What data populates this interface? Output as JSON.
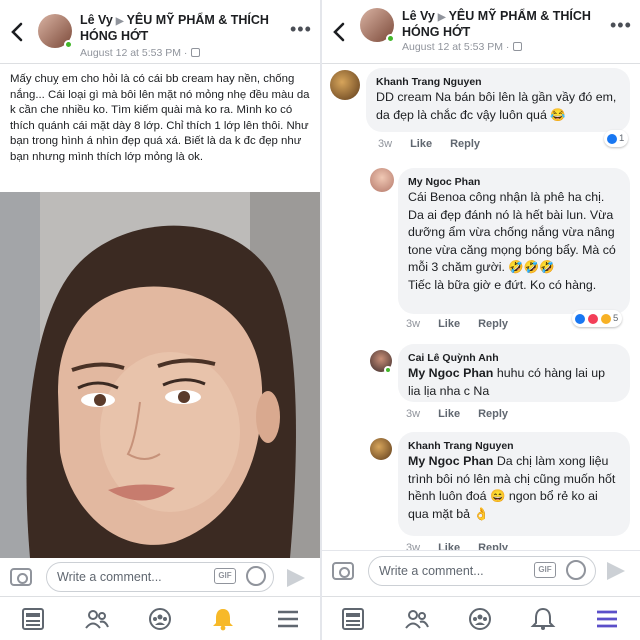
{
  "left": {
    "header": {
      "author": "Lê Vy",
      "group_line1": "YÊU MỸ PHẨM & THÍCH",
      "group_line2": "HÓNG HỚT",
      "date": "August 12 at 5:53 PM ·"
    },
    "post_text": "Mấy chuỵ em cho hỏi là có cái bb cream hay nền, chống nắng... Cái loại gì mà bôi lên mặt nó mỏng nhẹ đều màu da k cần che nhiều ko. Tìm kiếm quài mà ko ra. Mình ko có thích quánh cái mặt dày 8 lớp. Chỉ thích 1 lớp lên thôi. Như bạn trong hình á nhìn đẹp quá xá. Biết là da k đc đẹp như bạn nhưng mình thích lớp mỏng là ok.",
    "composer_placeholder": "Write a comment...",
    "gif_label": "GIF"
  },
  "right": {
    "header": {
      "author": "Lê Vy",
      "group_line1": "YÊU MỸ PHẨM & THÍCH",
      "group_line2": "HÓNG HỚT",
      "date": "August 12 at 5:53 PM ·"
    },
    "comments": [
      {
        "name": "Khanh Trang Nguyen",
        "text": "DD cream Na bán bôi lên là gần vầy đó em, da đẹp là chắc đc vậy luôn quá 😂",
        "time": "3w",
        "like": "Like",
        "reply": "Reply",
        "reaction_count": "1"
      },
      {
        "name": "My Ngoc Phan",
        "text": "Cái Benoa công nhận là phê ha chị. Da ai đẹp đánh nó là hết bài lun. Vừa dưỡng ẩm vừa chống nắng vừa nâng tone vừa căng mọng bóng bẩy. Mà có mỗi 3 chăm gười. 🤣🤣🤣",
        "text2": "Tiếc là bữa giờ e đứt. Ko có hàng.",
        "time": "3w",
        "like": "Like",
        "reply": "Reply",
        "reaction_count": "5"
      },
      {
        "name": "Cai Lê Quỳnh Anh",
        "mention": "My Ngoc Phan",
        "text": " huhu có hàng lai up lia lịa nha c Na",
        "time": "3w",
        "like": "Like",
        "reply": "Reply"
      },
      {
        "name": "Khanh Trang Nguyen",
        "mention": "My Ngoc Phan",
        "text": " Da chị làm xong liệu trình bôi nó lên mà chị cũng muốn hốt hềnh luôn đoá 😄 ngon bổ rẻ ko ai qua mặt bả 👌",
        "time": "3w",
        "like": "Like",
        "reply": "Reply"
      }
    ],
    "composer_placeholder": "Write a comment...",
    "gif_label": "GIF"
  },
  "colors": {
    "accent": "#4267b2",
    "notification_tab": "#f7b928",
    "menu_tab": "#5b4fc9",
    "online": "#42b72a",
    "bubble": "#f2f3f5",
    "meta_text": "#90949c"
  },
  "icons": {
    "back": "chevron-left-icon",
    "more": "more-dots-icon",
    "camera": "camera-icon",
    "gif": "gif-icon",
    "emoji": "smiley-icon",
    "send": "send-icon",
    "tabs": [
      "news-feed-icon",
      "friends-icon",
      "groups-icon",
      "notifications-icon",
      "menu-icon"
    ]
  }
}
